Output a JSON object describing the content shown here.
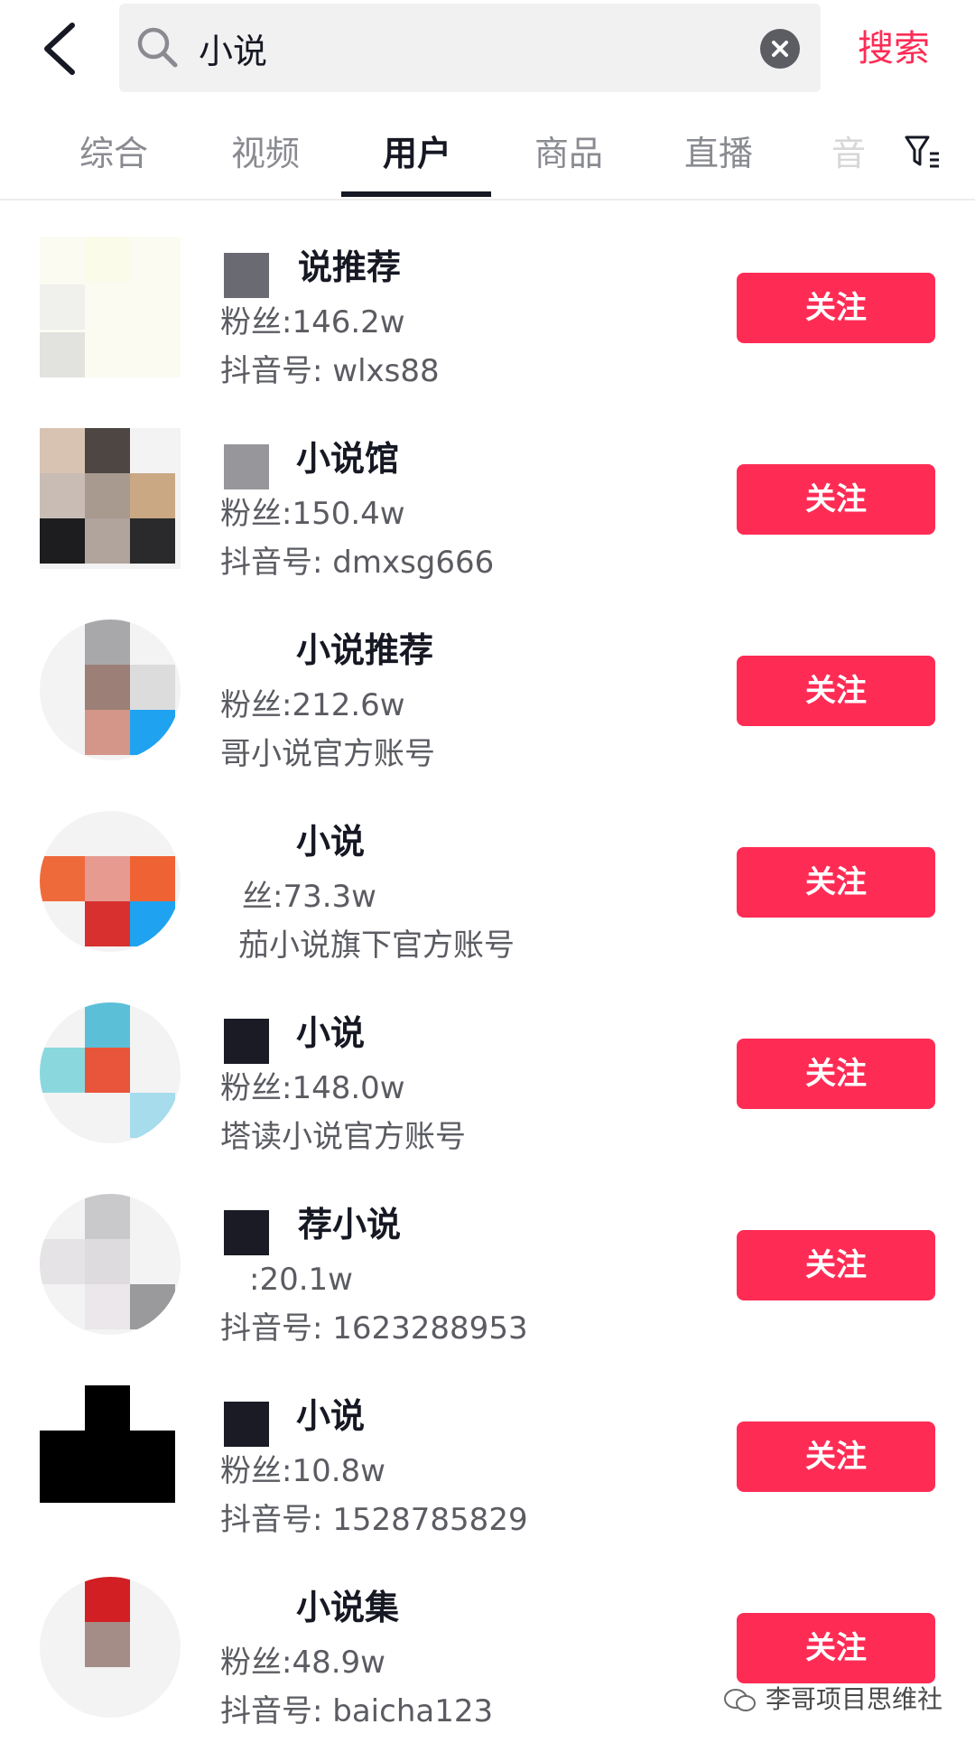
{
  "search": {
    "query": "小说",
    "submit_label": "搜索"
  },
  "tabs": [
    {
      "label": "综合",
      "active": false
    },
    {
      "label": "视频",
      "active": false
    },
    {
      "label": "用户",
      "active": true
    },
    {
      "label": "商品",
      "active": false
    },
    {
      "label": "直播",
      "active": false
    },
    {
      "label": "音",
      "active": false
    }
  ],
  "accent_color": "#fe2c55",
  "users": [
    {
      "name": "说推荐",
      "fans": "粉丝:146.2w",
      "sub": "抖音号: wlxs88",
      "follow_label": "关注"
    },
    {
      "name": "小说馆",
      "fans": "粉丝:150.4w",
      "sub": "抖音号: dmxsg666",
      "follow_label": "关注"
    },
    {
      "name": "小说推荐",
      "fans": "粉丝:212.6w",
      "sub": "哥小说官方账号",
      "follow_label": "关注"
    },
    {
      "name": "小说",
      "fans": "丝:73.3w",
      "sub": "茄小说旗下官方账号",
      "follow_label": "关注"
    },
    {
      "name": "小说",
      "fans": "粉丝:148.0w",
      "sub": "塔读小说官方账号",
      "follow_label": "关注"
    },
    {
      "name": "荐小说",
      "fans": ":20.1w",
      "sub": "抖音号: 1623288953",
      "follow_label": "关注"
    },
    {
      "name": "小说",
      "fans": "粉丝:10.8w",
      "sub": "抖音号: 1528785829",
      "follow_label": "关注"
    },
    {
      "name": "小说集",
      "fans": "粉丝:48.9w",
      "sub": "抖音号: baicha123",
      "follow_label": "关注"
    }
  ],
  "watermark": {
    "text": "李哥项目思维社",
    "icon": "wechat-icon"
  }
}
